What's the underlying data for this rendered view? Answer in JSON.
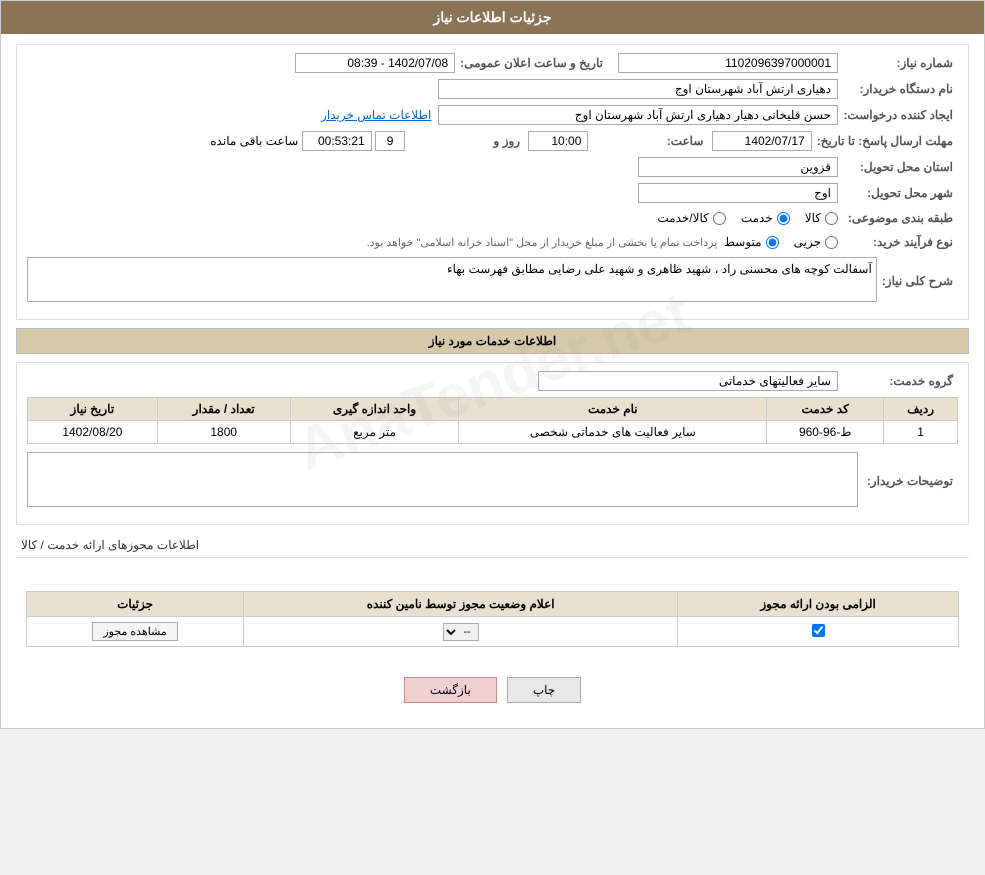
{
  "page": {
    "title": "جزئیات اطلاعات نیاز",
    "watermark": "AnaTender.net"
  },
  "header": {
    "request_number_label": "شماره نیاز:",
    "request_number_value": "1102096397000001",
    "announce_date_label": "تاریخ و ساعت اعلان عمومی:",
    "announce_date_value": "1402/07/08 - 08:39",
    "buyer_name_label": "نام دستگاه خریدار:",
    "buyer_name_value": "دهیاری ارتش آباد شهرستان اوج",
    "creator_label": "ایجاد کننده درخواست:",
    "creator_value": "حسن قلیخانی دهیار دهیاری ارتش آباد شهرستان اوج",
    "contact_link": "اطلاعات تماس خریدار",
    "response_deadline_label": "مهلت ارسال پاسخ: تا تاریخ:",
    "response_date": "1402/07/17",
    "response_time_label": "ساعت:",
    "response_time": "10:00",
    "response_days_label": "روز و",
    "response_days": "9",
    "response_remaining_label": "ساعت باقی مانده",
    "response_remaining": "00:53:21",
    "province_label": "استان محل تحویل:",
    "province_value": "قزوین",
    "city_label": "شهر محل تحویل:",
    "city_value": "اوج",
    "category_label": "طبقه بندی موضوعی:",
    "category_options": [
      "کالا",
      "خدمت",
      "کالا/خدمت"
    ],
    "category_selected": "خدمت",
    "purchase_type_label": "نوع فرآیند خرید:",
    "purchase_type_options": [
      "جزیی",
      "متوسط"
    ],
    "purchase_type_selected": "متوسط",
    "purchase_type_note": "پرداخت تمام یا بخشی از مبلغ خریدار از محل \"اسناد خزانه اسلامی\" خواهد بود.",
    "description_label": "شرح کلی نیاز:",
    "description_value": "آسفالت کوچه های محسنی راد ، شهید ظاهری و شهید علی رضایی مطابق فهرست بهاء"
  },
  "services_section": {
    "title": "اطلاعات خدمات مورد نیاز",
    "service_group_label": "گروه خدمت:",
    "service_group_value": "سایر فعالیتهای خدماتی",
    "table": {
      "columns": [
        "ردیف",
        "کد خدمت",
        "نام خدمت",
        "واحد اندازه گیری",
        "تعداد / مقدار",
        "تاریخ نیاز"
      ],
      "rows": [
        {
          "row": "1",
          "code": "ط-96-960",
          "name": "سایر فعالیت های خدماتی شخصی",
          "unit": "متر مربع",
          "quantity": "1800",
          "date": "1402/08/20"
        }
      ]
    },
    "buyer_notes_label": "توضیحات خریدار:",
    "buyer_notes_value": ""
  },
  "permits_section": {
    "subtitle": "اطلاعات مجوزهای ارائه خدمت / کالا",
    "table": {
      "columns": [
        "الزامی بودن ارائه مجوز",
        "اعلام وضعیت مجوز توسط نامین کننده",
        "جزئیات"
      ],
      "rows": [
        {
          "required": true,
          "status": "--",
          "details_btn": "مشاهده مجوز"
        }
      ]
    }
  },
  "buttons": {
    "print": "چاپ",
    "back": "بازگشت"
  }
}
